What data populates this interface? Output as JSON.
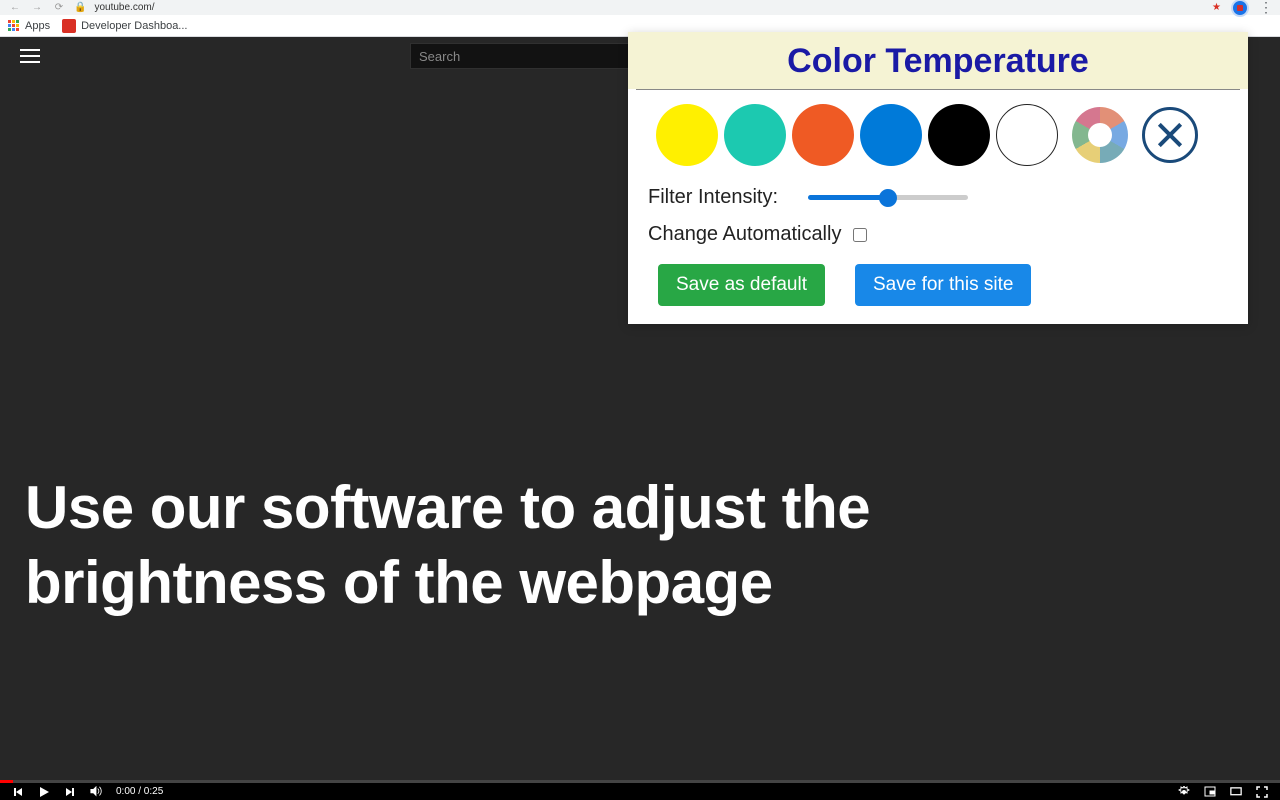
{
  "browser": {
    "url": "youtube.com/",
    "apps_label": "Apps",
    "bookmark": "Developer Dashboa..."
  },
  "yt": {
    "search_placeholder": "Search"
  },
  "overlay": {
    "headline": "Use our software to adjust the brightness of the webpage"
  },
  "player": {
    "time": "0:00 / 0:25"
  },
  "ext": {
    "title": "Color Temperature",
    "colors": [
      {
        "name": "yellow",
        "hex": "#fff000"
      },
      {
        "name": "teal",
        "hex": "#1cc9b0"
      },
      {
        "name": "orange",
        "hex": "#ef5a24"
      },
      {
        "name": "blue",
        "hex": "#007ad9"
      },
      {
        "name": "black",
        "hex": "#000000"
      },
      {
        "name": "white",
        "hex": "#ffffff"
      }
    ],
    "filter_label": "Filter Intensity:",
    "filter_value": 50,
    "auto_label": "Change Automatically",
    "auto_checked": false,
    "save_default": "Save as default",
    "save_site": "Save for this site"
  }
}
